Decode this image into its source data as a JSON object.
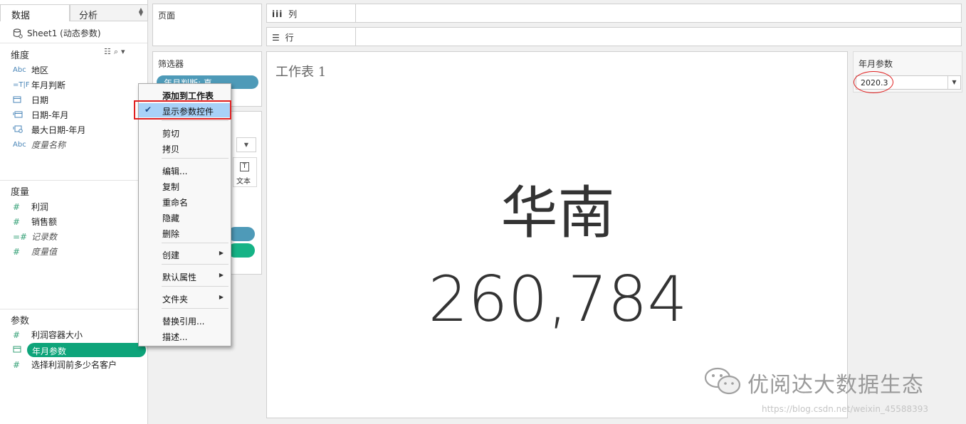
{
  "left_pane": {
    "tabs": [
      {
        "label": "数据"
      },
      {
        "label": "分析"
      }
    ],
    "datasource": "Sheet1 (动态参数)",
    "dimensions": {
      "title": "维度",
      "items": [
        {
          "type": "Abc",
          "label": "地区"
        },
        {
          "type": "=T|F",
          "label": "年月判断"
        },
        {
          "type": "date-icon",
          "label": "日期"
        },
        {
          "type": "date-calc-icon",
          "label": "日期-年月"
        },
        {
          "type": "date-calc-icon",
          "label": "最大日期-年月"
        },
        {
          "type": "Abc",
          "label": "度量名称"
        }
      ]
    },
    "measures": {
      "title": "度量",
      "items": [
        {
          "type": "#",
          "label": "利润"
        },
        {
          "type": "#",
          "label": "销售额"
        },
        {
          "type": "=#",
          "label": "记录数"
        },
        {
          "type": "#",
          "label": "度量值"
        }
      ]
    },
    "parameters": {
      "title": "参数",
      "items": [
        {
          "type": "#",
          "label": "利润容器大小"
        },
        {
          "type": "date-icon",
          "label": "年月参数"
        },
        {
          "type": "#",
          "label": "选择利润前多少名客户"
        }
      ]
    }
  },
  "shelves": {
    "pages": "页面",
    "columns_icon": "iii",
    "columns": "列",
    "rows_icon": "☰",
    "rows": "行",
    "filters": "筛选器",
    "filter_pill": "年月判断: 真",
    "marks_text_icon": "T",
    "marks_text_label": "文本"
  },
  "context_menu": {
    "items": [
      {
        "label": "添加到工作表",
        "bold": true
      },
      {
        "label": "显示参数控件",
        "checked": true,
        "highlighted": true
      },
      {
        "label": "剪切"
      },
      {
        "label": "拷贝"
      },
      {
        "label": "编辑..."
      },
      {
        "label": "复制"
      },
      {
        "label": "重命名"
      },
      {
        "label": "隐藏"
      },
      {
        "label": "删除"
      },
      {
        "label": "创建",
        "submenu": true
      },
      {
        "label": "默认属性",
        "submenu": true
      },
      {
        "label": "文件夹",
        "submenu": true
      },
      {
        "label": "替换引用..."
      },
      {
        "label": "描述..."
      }
    ]
  },
  "canvas": {
    "title": "工作表 1",
    "region": "华南",
    "value": "260,784"
  },
  "parameter_card": {
    "title": "年月参数",
    "value": "2020.3"
  },
  "watermark": {
    "text": "优阅达大数据生态",
    "url": "https://blog.csdn.net/weixin_45588393"
  },
  "colors": {
    "param_pill": "#0ea47a",
    "filter_pill": "#4e9ab8",
    "menu_highlight": "#a8d1f7",
    "annotation_red": "#e02020"
  }
}
